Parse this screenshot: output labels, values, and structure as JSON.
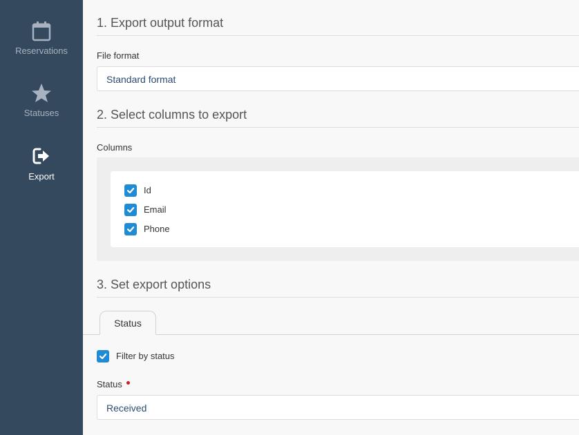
{
  "sidebar": {
    "items": [
      {
        "label": "Reservations",
        "icon": "calendar-icon"
      },
      {
        "label": "Statuses",
        "icon": "star-icon"
      },
      {
        "label": "Export",
        "icon": "export-icon",
        "active": true
      }
    ]
  },
  "sections": {
    "format": {
      "title": "1. Export output format",
      "field_label": "File format",
      "value": "Standard format"
    },
    "columns": {
      "title": "2. Select columns to export",
      "field_label": "Columns",
      "items": [
        {
          "label": "Id",
          "checked": true
        },
        {
          "label": "Email",
          "checked": true
        },
        {
          "label": "Phone",
          "checked": true
        }
      ]
    },
    "options": {
      "title": "3. Set export options",
      "tabs": [
        {
          "label": "Status",
          "active": true
        }
      ],
      "filter_label": "Filter by status",
      "filter_checked": true,
      "status_label": "Status",
      "status_required": true,
      "status_value": "Received"
    }
  },
  "colors": {
    "sidebar_bg": "#34495e",
    "checkbox_accent": "#1e8bd4",
    "required_dot": "#cc1f1f",
    "select_text": "#2b4a73"
  }
}
